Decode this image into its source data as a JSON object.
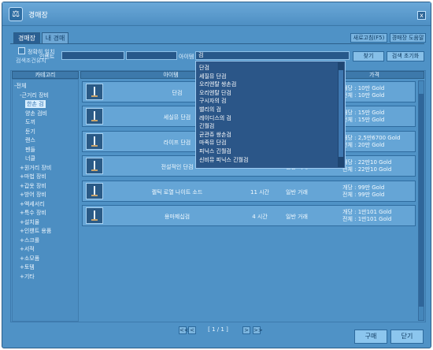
{
  "window": {
    "title": "경매장",
    "logo_glyph": "⚖",
    "close_glyph": "x"
  },
  "tabs": [
    {
      "label": "경매장",
      "active": true
    },
    {
      "label": "내 경매",
      "active": false
    }
  ],
  "top_buttons": {
    "refresh": "새로고침(F5)",
    "help": "경매장 도움말"
  },
  "filters": {
    "exact_match_label": "정확히 일치",
    "keep_settings_label": "검색조건유지",
    "level_label": "인벤트",
    "level_value_from": "",
    "level_value_to": "",
    "item_name_label": "아이템",
    "item_name_value": "검",
    "search_button": "찾기",
    "reset_button": "검색 초기화"
  },
  "columns": {
    "category": "카테고리",
    "item": "아이템",
    "time": "",
    "price": "가격"
  },
  "categories": [
    {
      "label": "-전체",
      "indent": 0
    },
    {
      "label": "-근거리 장비",
      "indent": 1
    },
    {
      "label": "한손 검",
      "indent": 2,
      "selected": true
    },
    {
      "label": "양손 검비",
      "indent": 2
    },
    {
      "label": "도끼",
      "indent": 2
    },
    {
      "label": "둔기",
      "indent": 2
    },
    {
      "label": "랜스",
      "indent": 2
    },
    {
      "label": "펜들",
      "indent": 2
    },
    {
      "label": "너클",
      "indent": 2
    },
    {
      "label": "+원거리 장비",
      "indent": 1
    },
    {
      "label": "+마법 장비",
      "indent": 1
    },
    {
      "label": "+갑옷 장비",
      "indent": 1
    },
    {
      "label": "+방어 장비",
      "indent": 1
    },
    {
      "label": "+액세서리",
      "indent": 1
    },
    {
      "label": "+특수 장비",
      "indent": 1
    },
    {
      "label": "+설치물",
      "indent": 1
    },
    {
      "label": "+인챈트 용품",
      "indent": 1
    },
    {
      "label": "+스크롤",
      "indent": 1
    },
    {
      "label": "+서적",
      "indent": 1
    },
    {
      "label": "+소모품",
      "indent": 1
    },
    {
      "label": "+토템",
      "indent": 1
    },
    {
      "label": "+기타",
      "indent": 1
    }
  ],
  "items": [
    {
      "name": "단검",
      "time": "",
      "type": "",
      "unit": "개당 : 10만 Gold",
      "total": "전체 : 10만 Gold"
    },
    {
      "name": "세실뮤 단검",
      "time": "",
      "type": "",
      "unit": "개당 : 15만 Gold",
      "total": "전체 : 15만 Gold"
    },
    {
      "name": "라이프 단검",
      "time": "",
      "type": "",
      "unit": "개당 : 2,5만6700 Gold",
      "total": "전체 : 20만 Gold"
    },
    {
      "name": "전설적인 단검",
      "time": "",
      "type": "일반 거래",
      "unit": "개당 : 22만10 Gold",
      "total": "전체 : 22만10 Gold"
    },
    {
      "name": "켈틱 로열 나이트 소드",
      "time": "11 시간",
      "type": "일반 거래",
      "unit": "개당 : 99만 Gold",
      "total": "전체 : 99만 Gold"
    },
    {
      "name": "용마제십검",
      "time": "4 시간",
      "type": "일반 거래",
      "unit": "개당 : 1만101 Gold",
      "total": "전체 : 1만101 Gold"
    }
  ],
  "dropdown": {
    "options": [
      "단검",
      "세질뮤 단검",
      "오리엔탈 쌍손검",
      "오리엔탈 단검",
      "구시자의 검",
      "밸리의 검",
      "레이디스의 검",
      "긴월검",
      "균관쥬 쌍손검",
      "마족뮤 단검",
      "피닉스 긴월검",
      "신비뮤 피닉스 긴월검"
    ]
  },
  "pager": {
    "first": "<<",
    "prev": "<",
    "page_text": "[ 1 / 1 ]",
    "next": ">",
    "last": ">>"
  },
  "bottom_buttons": {
    "buy": "구매",
    "close": "닫기"
  }
}
